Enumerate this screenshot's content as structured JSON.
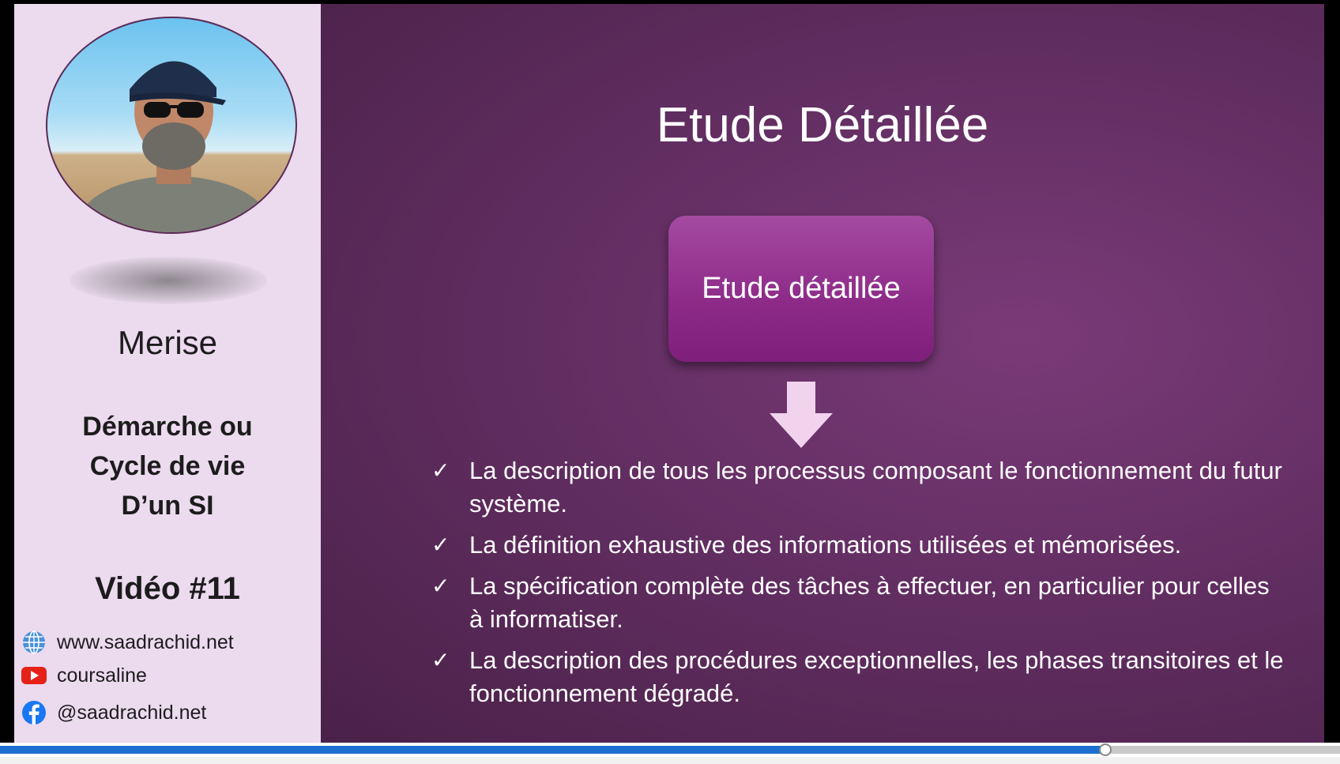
{
  "sidebar": {
    "course_title": "Merise",
    "topic_lines": [
      "Démarche ou",
      "Cycle de vie",
      "D’un SI"
    ],
    "video_number": "Vidéo #11",
    "links": [
      {
        "icon": "globe-icon",
        "text": "www.saadrachid.net"
      },
      {
        "icon": "youtube-icon",
        "text": "coursaline"
      },
      {
        "icon": "facebook-icon",
        "text": "@saadrachid.net"
      }
    ]
  },
  "slide": {
    "title": "Etude Détaillée",
    "box_label": "Etude détaillée",
    "bullets": [
      "La description de tous les processus composant le fonctionnement du futur système.",
      "La définition exhaustive des informations utilisées et mémorisées.",
      "La spécification complète des tâches à effectuer, en particulier pour celles à informatiser.",
      "La description des procédures exceptionnelles, les phases transitoires et le fonctionnement dégradé."
    ]
  },
  "player": {
    "progress_fraction": 0.825
  },
  "colors": {
    "slide_bg": "#5e2c5e",
    "box_bg": "#8d2a88",
    "sidebar_bg": "#ecdaef",
    "progress": "#1d6fd1"
  }
}
